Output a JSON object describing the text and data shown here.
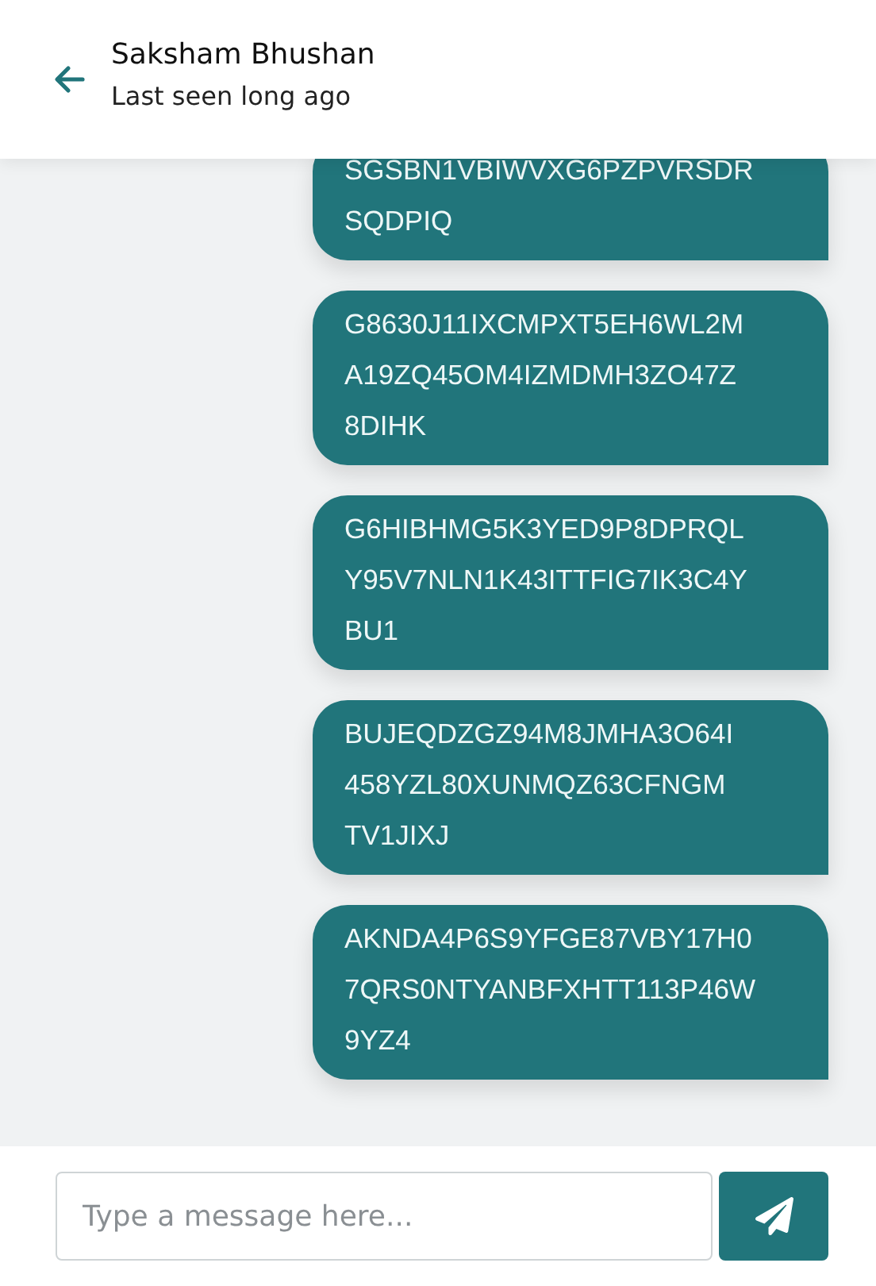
{
  "header": {
    "name": "Saksham Bhushan",
    "status": "Last seen long ago"
  },
  "messages": [
    {
      "lines": [
        "SGSBN1VBIWVXG6PZPVRSDR",
        "SQDPIQ"
      ]
    },
    {
      "lines": [
        "G8630J11IXCMPXT5EH6WL2M",
        "A19ZQ45OM4IZMDMH3ZO47Z",
        "8DIHK"
      ]
    },
    {
      "lines": [
        "G6HIBHMG5K3YED9P8DPRQL",
        "Y95V7NLN1K43ITTFIG7IK3C4Y",
        "BU1"
      ]
    },
    {
      "lines": [
        "BUJEQDZGZ94M8JMHA3O64I",
        "458YZL80XUNMQZ63CFNGM",
        "TV1JIXJ"
      ]
    },
    {
      "lines": [
        "AKNDA4P6S9YFGE87VBY17H0",
        "7QRS0NTYANBFXHTT113P46W",
        "9YZ4"
      ]
    }
  ],
  "composer": {
    "placeholder": "Type a message here..."
  }
}
